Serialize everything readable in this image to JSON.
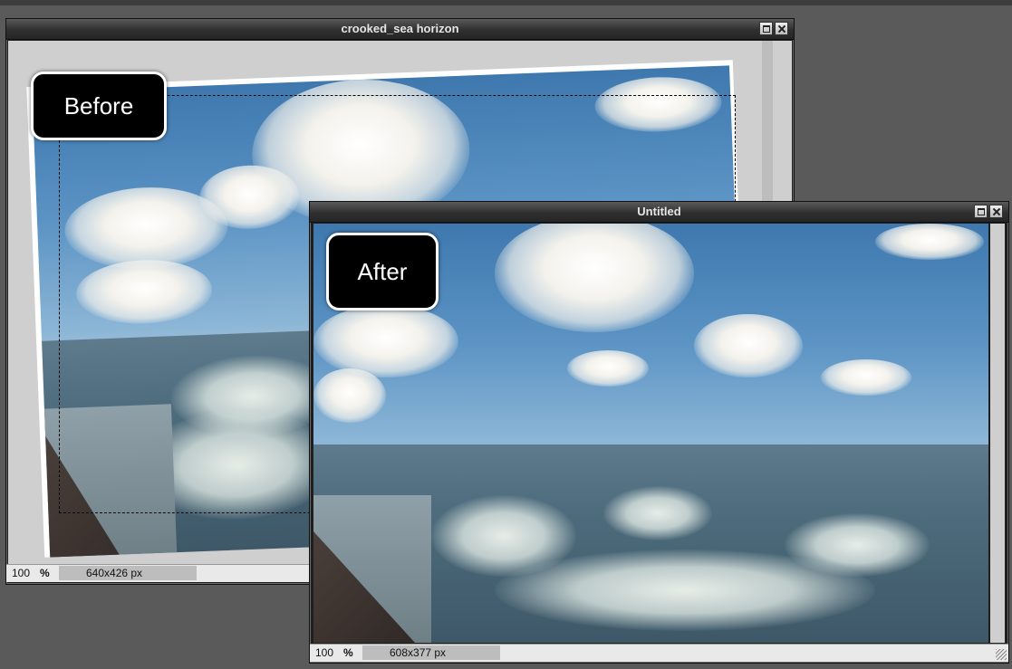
{
  "before_window": {
    "title": "crooked_sea horizon",
    "badge": "Before",
    "zoom": "100",
    "zoom_unit": "%",
    "dimensions": "640x426 px"
  },
  "after_window": {
    "title": "Untitled",
    "badge": "After",
    "zoom": "100",
    "zoom_unit": "%",
    "dimensions": "608x377 px"
  },
  "colors": {
    "workspace": "#5a5a5a",
    "titlebar": "#2f2f2f",
    "badge_bg": "#000000",
    "statusbar": "#e9e9e9"
  }
}
